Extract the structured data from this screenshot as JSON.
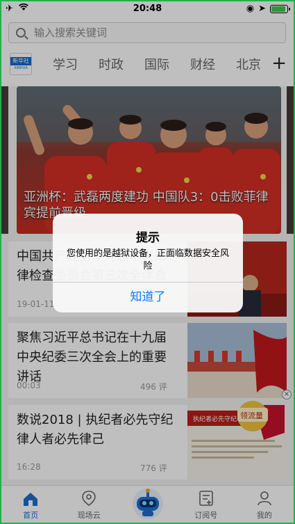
{
  "status_bar": {
    "time": "20:48"
  },
  "search": {
    "placeholder": "输入搜索关键词"
  },
  "channels": {
    "logo_text": "新华社",
    "tabs": [
      "学习",
      "时政",
      "国际",
      "财经",
      "北京"
    ],
    "add_label": "+"
  },
  "hero": {
    "caption": "亚洲杯：武磊两度建功 中国队3：0击败菲律宾提前晋级"
  },
  "news": [
    {
      "title": "中国共产党第十九届中央纪律检查委员会第三次全体会议公报",
      "date": "19-01-11",
      "comments": ""
    },
    {
      "title": "聚焦习近平总书记在十九届中央纪委三次全会上的重要讲话",
      "date": "00:03",
      "comments": "496 评"
    },
    {
      "title": "数说2018 | 执纪者必先守纪 律人者必先律己",
      "date": "16:28",
      "comments": "776 评"
    }
  ],
  "news3_image": {
    "banner": "执纪者必先守纪",
    "badge": "领流量"
  },
  "bottom_nav": {
    "home": "首页",
    "scene": "现场云",
    "subscribe": "订阅号",
    "mine": "我的"
  },
  "alert": {
    "title": "提示",
    "message": "您使用的是越狱设备，正面临数据安全风险",
    "button": "知道了"
  },
  "colors": {
    "accent": "#1b6fd1",
    "alert_button": "#0a7aff",
    "frame": "#1fb24a"
  }
}
